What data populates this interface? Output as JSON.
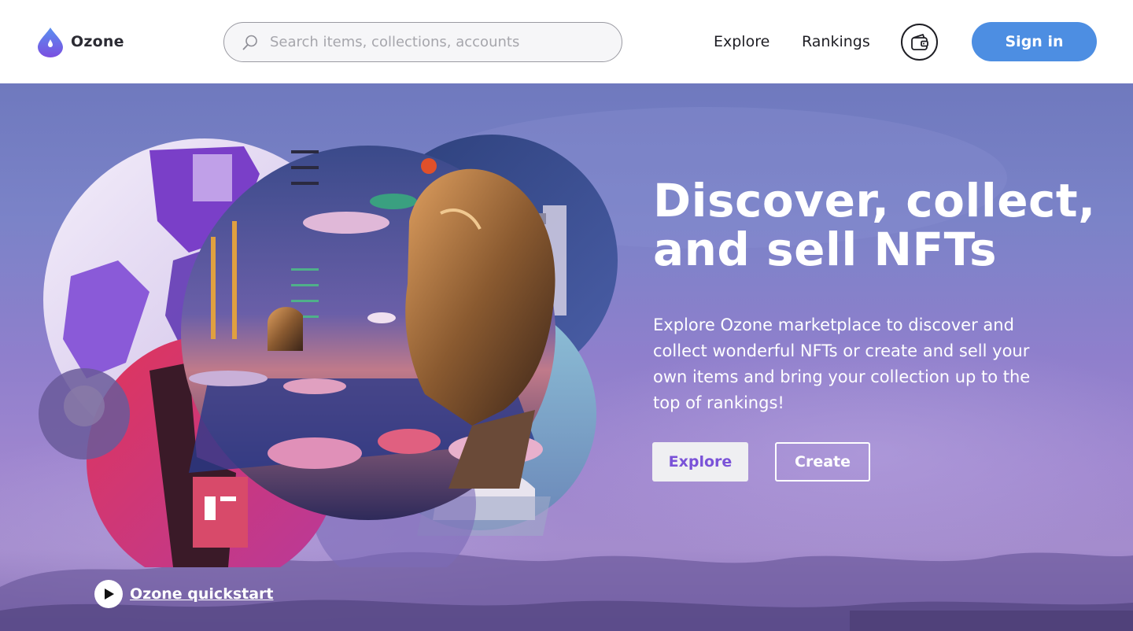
{
  "header": {
    "logo_text": "Ozone",
    "search_placeholder": "Search items, collections, accounts",
    "nav": {
      "explore": "Explore",
      "rankings": "Rankings"
    },
    "signin_label": "Sign in"
  },
  "hero": {
    "title": "Discover, collect, and sell NFTs",
    "description": "Explore Ozone marketplace  to discover and collect wonderful NFTs or create and sell your own items and bring your collection up to the top of rankings!",
    "explore_label": "Explore",
    "create_label": "Create",
    "quickstart_label": "Ozone quickstart"
  },
  "colors": {
    "brand_blue": "#4d8ee2",
    "explore_text": "#7a52d8",
    "hero_bg": "#8f7fcc"
  },
  "icons": {
    "logo": "droplet-icon",
    "search": "search-icon",
    "wallet": "wallet-icon",
    "play": "play-icon"
  }
}
